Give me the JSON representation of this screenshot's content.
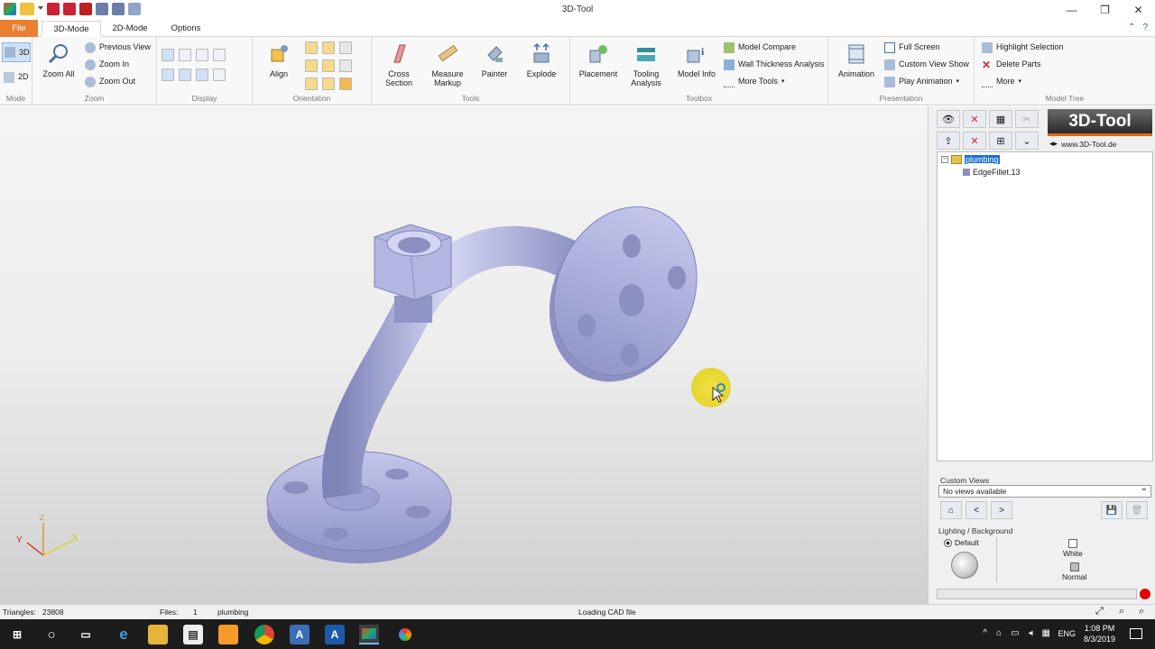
{
  "window": {
    "title": "3D-Tool",
    "minimize": "—",
    "maximize": "❐",
    "close": "✕"
  },
  "tabs": {
    "file": "File",
    "mode3d": "3D-Mode",
    "mode2d": "2D-Mode",
    "options": "Options"
  },
  "ribbon": {
    "mode": {
      "label": "Mode",
      "btn3d": "3D",
      "btn2d": "2D"
    },
    "zoom": {
      "label": "Zoom",
      "zoom_all": "Zoom All",
      "previous_view": "Previous View",
      "zoom_in": "Zoom In",
      "zoom_out": "Zoom Out"
    },
    "display": {
      "label": "Display"
    },
    "orientation": {
      "label": "Orientation",
      "align": "Align"
    },
    "tools": {
      "label": "Tools",
      "cross_section": "Cross Section",
      "measure_markup": "Measure Markup",
      "painter": "Painter",
      "explode": "Explode"
    },
    "toolbox": {
      "label": "Toolbox",
      "placement": "Placement",
      "tooling_analysis": "Tooling Analysis",
      "model_info": "Model Info",
      "model_compare": "Model Compare",
      "wall_thickness": "Wall Thickness Analysis",
      "more_tools": "More Tools"
    },
    "presentation": {
      "label": "Presentation",
      "animation": "Animation",
      "full_screen": "Full Screen",
      "custom_view_show": "Custom View Show",
      "play_animation": "Play Animation"
    },
    "model_tree": {
      "label": "Model Tree",
      "highlight_selection": "Highlight Selection",
      "delete_parts": "Delete Parts",
      "more": "More"
    }
  },
  "panel": {
    "logo": "3D-Tool",
    "url": "www.3D-Tool.de",
    "tree": {
      "root": "plumbing",
      "child": "EdgeFillet.13"
    },
    "custom_views": {
      "label": "Custom Views",
      "value": "No views available",
      "prev": "<",
      "next": ">"
    },
    "lighting": {
      "label": "Lighting / Background",
      "default": "Default",
      "white": "White",
      "normal": "Normal"
    }
  },
  "axes": {
    "x": "X",
    "y": "Y",
    "z": "Z"
  },
  "status": {
    "triangles_label": "Triangles:",
    "triangles": "23808",
    "files_label": "Files:",
    "files": "1",
    "model": "plumbing",
    "message": "Loading CAD file"
  },
  "taskbar": {
    "lang": "ENG",
    "time": "1:08 PM",
    "date": "8/3/2019"
  },
  "colors": {
    "file_tab": "#e97f31",
    "model": "#aaaeda",
    "accent": "#1e6ed8",
    "cursor_highlight": "#e8d51f"
  }
}
